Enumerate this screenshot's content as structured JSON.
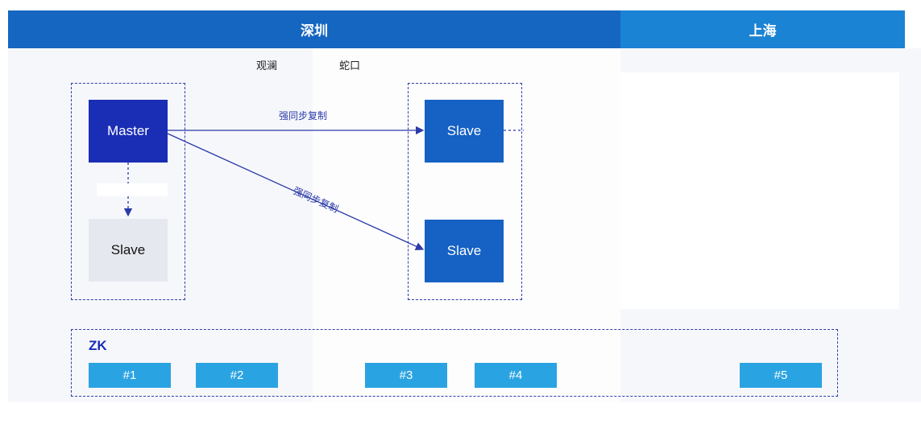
{
  "header": {
    "shenzhen": "深圳",
    "shanghai": "上海"
  },
  "zones": {
    "guanlan": "观澜",
    "shekou": "蛇口"
  },
  "nodes": {
    "master": "Master",
    "slave_local": "Slave",
    "slave_shekou_1": "Slave",
    "slave_shekou_2": "Slave"
  },
  "edges": {
    "sync_1": "强同步复制",
    "sync_2": "强同步复制"
  },
  "zk": {
    "title": "ZK",
    "nodes": [
      "#1",
      "#2",
      "#3",
      "#4",
      "#5"
    ]
  },
  "colors": {
    "header_shenzhen": "#1566c0",
    "header_shanghai": "#1b83d4",
    "master": "#1a2db5",
    "slave_remote": "#1561c4",
    "slave_local": "#e6e8ef",
    "zk_node": "#2aa3e2",
    "dashed_border": "#2f3ea8"
  }
}
